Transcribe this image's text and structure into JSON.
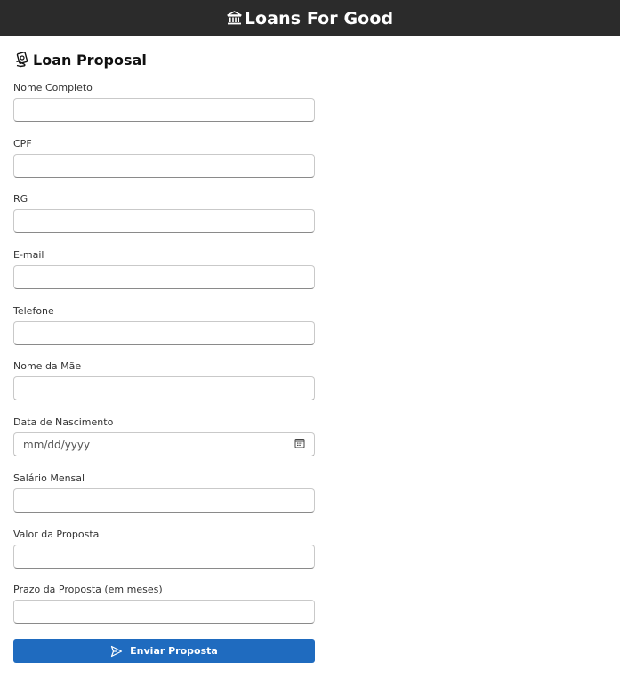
{
  "header": {
    "brand_icon": "bank-icon",
    "brand_title": "Loans For Good"
  },
  "page": {
    "title_icon": "money-hand-icon",
    "title": "Loan Proposal"
  },
  "form": {
    "fields": [
      {
        "label": "Nome Completo",
        "value": ""
      },
      {
        "label": "CPF",
        "value": ""
      },
      {
        "label": "RG",
        "value": ""
      },
      {
        "label": "E-mail",
        "value": ""
      },
      {
        "label": "Telefone",
        "value": ""
      },
      {
        "label": "Nome da Mãe",
        "value": ""
      },
      {
        "label": "Data de Nascimento",
        "placeholder": "mm/dd/yyyy",
        "icon": "calendar-icon"
      },
      {
        "label": "Salário Mensal",
        "value": ""
      },
      {
        "label": "Valor da Proposta",
        "value": ""
      },
      {
        "label": "Prazo da Proposta (em meses)",
        "value": ""
      }
    ],
    "submit": {
      "icon": "send-icon",
      "label": "Enviar Proposta",
      "color": "#1f6bbf"
    }
  },
  "colors": {
    "topbar": "#2b2b2b",
    "accent": "#1f6bbf"
  }
}
